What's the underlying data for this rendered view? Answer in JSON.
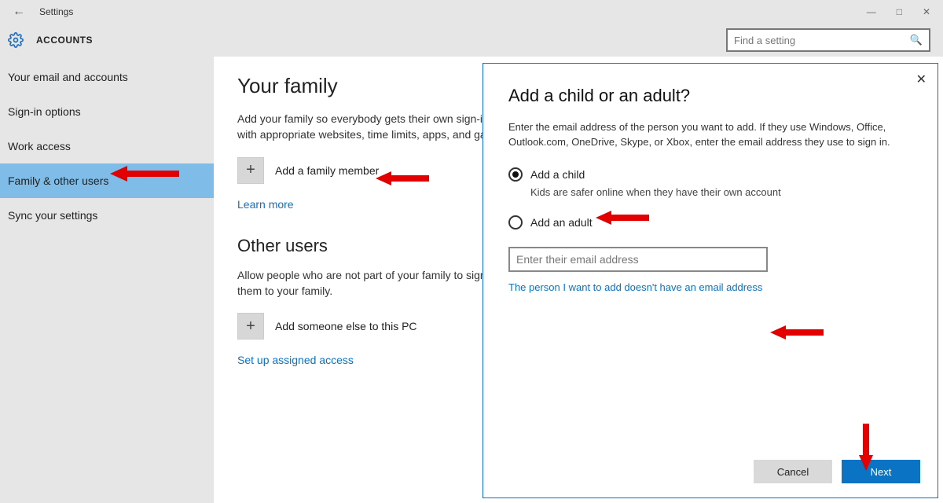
{
  "window": {
    "title": "Settings",
    "section": "ACCOUNTS",
    "search_placeholder": "Find a setting"
  },
  "sidebar": {
    "items": [
      {
        "label": "Your email and accounts"
      },
      {
        "label": "Sign-in options"
      },
      {
        "label": "Work access"
      },
      {
        "label": "Family & other users"
      },
      {
        "label": "Sync your settings"
      }
    ]
  },
  "main": {
    "family_heading": "Your family",
    "family_desc": "Add your family so everybody gets their own sign-in and desktop. You can help kids stay safe with appropriate websites, time limits, apps, and games.",
    "add_family_label": "Add a family member",
    "learn_more": "Learn more",
    "other_heading": "Other users",
    "other_desc": "Allow people who are not part of your family to sign in with their own accounts. This won't add them to your family.",
    "add_someone_label": "Add someone else to this PC",
    "assigned_access": "Set up assigned access"
  },
  "dialog": {
    "title": "Add a child or an adult?",
    "intro": "Enter the email address of the person you want to add. If they use Windows, Office, Outlook.com, OneDrive, Skype, or Xbox, enter the email address they use to sign in.",
    "opt_child": "Add a child",
    "opt_child_sub": "Kids are safer online when they have their own account",
    "opt_adult": "Add an adult",
    "email_placeholder": "Enter their email address",
    "no_email_link": "The person I want to add doesn't have an email address",
    "cancel": "Cancel",
    "next": "Next"
  }
}
